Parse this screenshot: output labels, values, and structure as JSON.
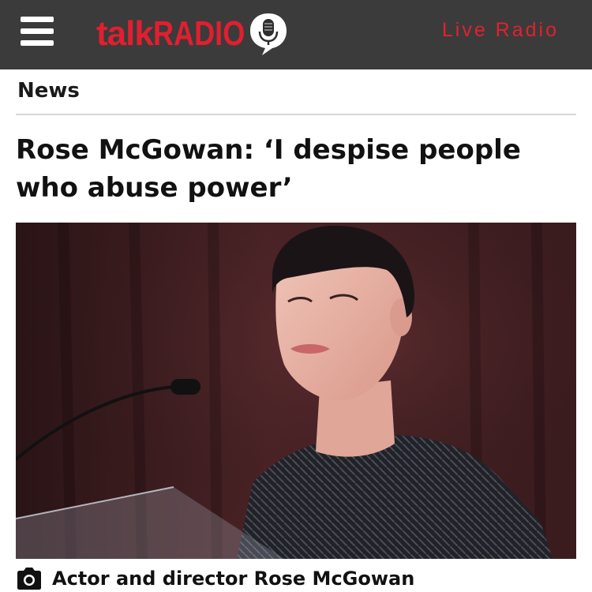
{
  "header": {
    "menu_icon": "hamburger-menu-icon",
    "brand": {
      "talk": "talk",
      "radio": "RADIO",
      "icon": "microphone-speech-bubble-icon"
    },
    "live_radio_label": "Live Radio",
    "colors": {
      "bar": "#3b3b3b",
      "accent": "#e11f2f"
    }
  },
  "section": {
    "label": "News"
  },
  "article": {
    "headline": "Rose McGowan: ‘I despise people who abuse power’",
    "image": {
      "subject": "photo-of-speaker-at-podium"
    },
    "caption": {
      "icon": "camera-icon",
      "text": "Actor and director Rose McGowan"
    }
  }
}
